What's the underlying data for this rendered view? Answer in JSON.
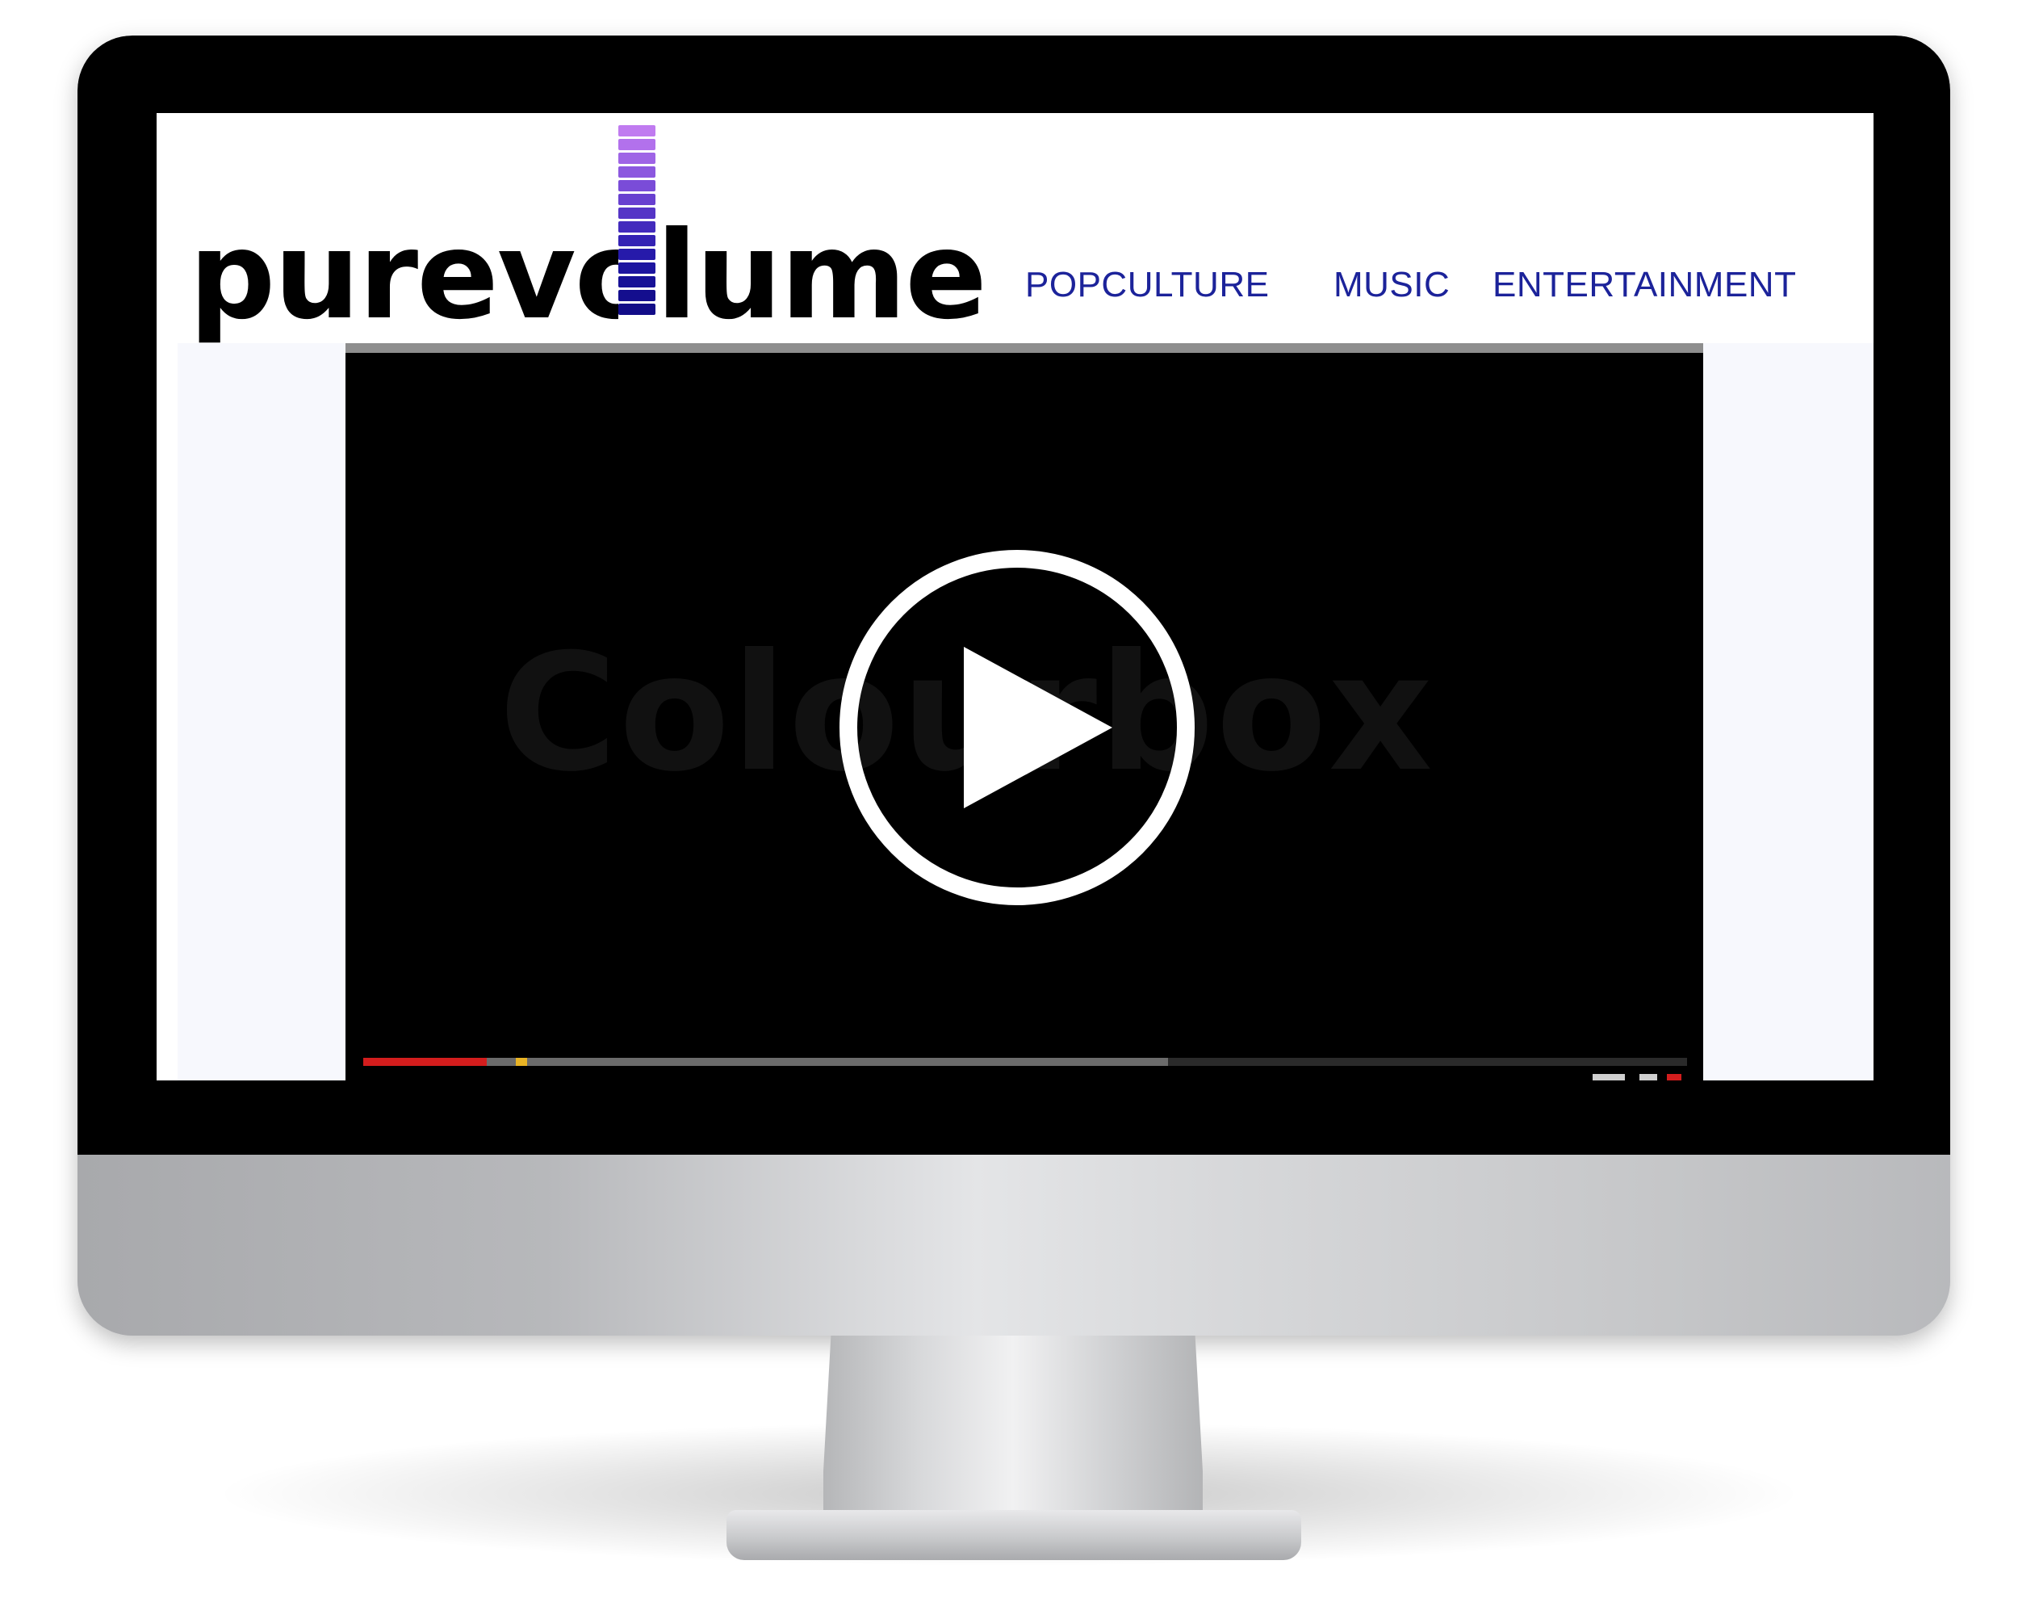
{
  "site": {
    "logo_text": "purevolume",
    "logo_meter_colors": [
      "#c07bf0",
      "#b271ec",
      "#9f64e6",
      "#8c58df",
      "#7a4cd8",
      "#6840d0",
      "#5535c6",
      "#432bbd",
      "#3422b4",
      "#261aaa",
      "#1d15a0",
      "#171197",
      "#140e8e",
      "#120c88"
    ]
  },
  "nav": {
    "items": [
      "POPCULTURE",
      "MUSIC",
      "ENTERTAINMENT"
    ],
    "color": "#1c239a"
  },
  "player": {
    "watermark": "Colourbox",
    "played_fraction": 0.093,
    "buffered_fraction": 0.608,
    "marker_fraction": 0.115,
    "accent_played": "#d31d1d",
    "accent_marker": "#e8b325"
  },
  "icons": {
    "play": "play-icon"
  }
}
